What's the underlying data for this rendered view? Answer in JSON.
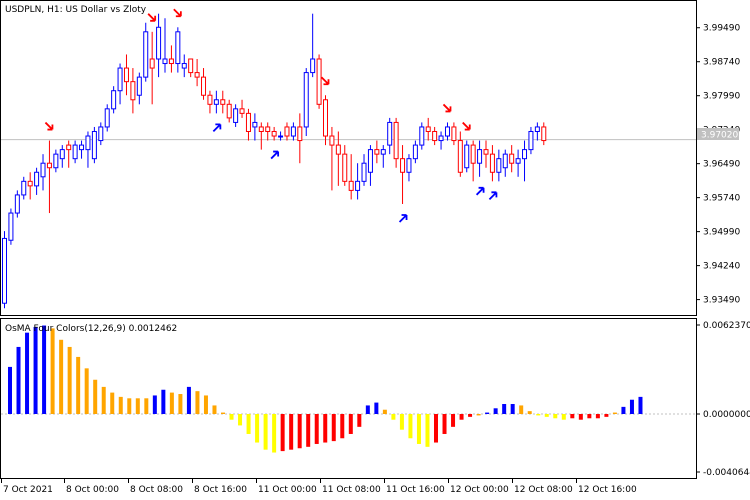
{
  "main": {
    "title": "USDPLN, H1:  US Dollar vs Zloty",
    "price_tag": "3.97020"
  },
  "indicator": {
    "title": "OsMA Four Colors(12,26,9) 0.0012462"
  },
  "chart_data": [
    {
      "type": "candlestick",
      "symbol": "USDPLN",
      "timeframe": "H1",
      "title": "USDPLN, H1:  US Dollar vs Zloty",
      "current_price": 3.9702,
      "ylim": [
        3.9315,
        4.0008
      ],
      "y_ticks": [
        "3.99490",
        "3.98740",
        "3.97990",
        "3.97240",
        "3.96490",
        "3.95740",
        "3.94990",
        "3.94240",
        "3.93490"
      ],
      "x_ticks": [
        "7 Oct 2021",
        "8 Oct 00:00",
        "8 Oct 08:00",
        "8 Oct 16:00",
        "11 Oct 00:00",
        "11 Oct 08:00",
        "11 Oct 16:00",
        "12 Oct 00:00",
        "12 Oct 08:00",
        "12 Oct 16:00"
      ],
      "colors": {
        "bull": "#0000ff",
        "bear": "#ff0000",
        "up_arrow": "#0000ff",
        "down_arrow": "#ff0000",
        "price_line": "#c0c0c0"
      },
      "candles": [
        [
          3.9341,
          3.95,
          3.933,
          3.9484
        ],
        [
          3.948,
          3.955,
          3.947,
          3.954
        ],
        [
          3.954,
          3.959,
          3.953,
          3.958
        ],
        [
          3.958,
          3.962,
          3.957,
          3.961
        ],
        [
          3.961,
          3.963,
          3.957,
          3.96
        ],
        [
          3.96,
          3.964,
          3.958,
          3.963
        ],
        [
          3.962,
          3.967,
          3.959,
          3.965
        ],
        [
          3.965,
          3.97,
          3.954,
          3.964
        ],
        [
          3.964,
          3.968,
          3.963,
          3.967
        ],
        [
          3.966,
          3.969,
          3.964,
          3.968
        ],
        [
          3.969,
          3.97,
          3.964,
          3.968
        ],
        [
          3.966,
          3.97,
          3.965,
          3.969
        ],
        [
          3.968,
          3.97,
          3.966,
          3.969
        ],
        [
          3.968,
          3.972,
          3.964,
          3.971
        ],
        [
          3.966,
          3.973,
          3.965,
          3.972
        ],
        [
          3.97,
          3.974,
          3.969,
          3.973
        ],
        [
          3.973,
          3.978,
          3.972,
          3.977
        ],
        [
          3.977,
          3.982,
          3.976,
          3.981
        ],
        [
          3.981,
          3.987,
          3.978,
          3.986
        ],
        [
          3.986,
          3.989,
          3.98,
          3.983
        ],
        [
          3.983,
          3.986,
          3.976,
          3.979
        ],
        [
          3.98,
          3.985,
          3.978,
          3.984
        ],
        [
          3.984,
          3.996,
          3.983,
          3.994
        ],
        [
          3.988,
          3.994,
          3.978,
          3.986
        ],
        [
          3.988,
          3.998,
          3.984,
          3.995
        ],
        [
          3.987,
          3.997,
          3.985,
          3.988
        ],
        [
          3.988,
          3.991,
          3.985,
          3.987
        ],
        [
          3.987,
          3.995,
          3.985,
          3.994
        ],
        [
          3.986,
          3.989,
          3.984,
          3.987
        ],
        [
          3.988,
          3.988,
          3.984,
          3.985
        ],
        [
          3.985,
          3.988,
          3.982,
          3.984
        ],
        [
          3.984,
          3.986,
          3.979,
          3.98
        ],
        [
          3.98,
          3.981,
          3.976,
          3.978
        ],
        [
          3.978,
          3.981,
          3.976,
          3.979
        ],
        [
          3.979,
          3.981,
          3.976,
          3.978
        ],
        [
          3.978,
          3.979,
          3.974,
          3.975
        ],
        [
          3.974,
          3.978,
          3.973,
          3.977
        ],
        [
          3.977,
          3.979,
          3.975,
          3.976
        ],
        [
          3.976,
          3.977,
          3.97,
          3.972
        ],
        [
          3.973,
          3.976,
          3.97,
          3.974
        ],
        [
          3.973,
          3.974,
          3.968,
          3.972
        ],
        [
          3.973,
          3.974,
          3.97,
          3.972
        ],
        [
          3.972,
          3.973,
          3.97,
          3.971
        ],
        [
          3.971,
          3.972,
          3.97,
          3.971
        ],
        [
          3.973,
          3.974,
          3.97,
          3.971
        ],
        [
          3.971,
          3.974,
          3.97,
          3.973
        ],
        [
          3.973,
          3.976,
          3.965,
          3.97
        ],
        [
          3.973,
          3.986,
          3.971,
          3.985
        ],
        [
          3.985,
          3.998,
          3.984,
          3.988
        ],
        [
          3.988,
          3.989,
          3.977,
          3.978
        ],
        [
          3.979,
          3.98,
          3.969,
          3.971
        ],
        [
          3.971,
          3.973,
          3.959,
          3.969
        ],
        [
          3.969,
          3.972,
          3.96,
          3.967
        ],
        [
          3.967,
          3.969,
          3.96,
          3.961
        ],
        [
          3.961,
          3.967,
          3.957,
          3.959
        ],
        [
          3.959,
          3.965,
          3.957,
          3.961
        ],
        [
          3.961,
          3.967,
          3.96,
          3.965
        ],
        [
          3.963,
          3.969,
          3.96,
          3.968
        ],
        [
          3.968,
          3.97,
          3.965,
          3.967
        ],
        [
          3.967,
          3.969,
          3.964,
          3.968
        ],
        [
          3.969,
          3.975,
          3.967,
          3.974
        ],
        [
          3.974,
          3.975,
          3.964,
          3.966
        ],
        [
          3.966,
          3.969,
          3.956,
          3.963
        ],
        [
          3.963,
          3.967,
          3.961,
          3.966
        ],
        [
          3.966,
          3.97,
          3.965,
          3.969
        ],
        [
          3.969,
          3.974,
          3.968,
          3.973
        ],
        [
          3.973,
          3.975,
          3.97,
          3.972
        ],
        [
          3.972,
          3.973,
          3.969,
          3.97
        ],
        [
          3.97,
          3.972,
          3.968,
          3.971
        ],
        [
          3.971,
          3.974,
          3.97,
          3.973
        ],
        [
          3.973,
          3.974,
          3.969,
          3.97
        ],
        [
          3.97,
          3.972,
          3.962,
          3.963
        ],
        [
          3.964,
          3.97,
          3.963,
          3.969
        ],
        [
          3.969,
          3.97,
          3.961,
          3.965
        ],
        [
          3.965,
          3.97,
          3.962,
          3.968
        ],
        [
          3.968,
          3.97,
          3.964,
          3.967
        ],
        [
          3.967,
          3.969,
          3.961,
          3.963
        ],
        [
          3.963,
          3.968,
          3.961,
          3.966
        ],
        [
          3.964,
          3.968,
          3.962,
          3.967
        ],
        [
          3.967,
          3.969,
          3.963,
          3.965
        ],
        [
          3.965,
          3.968,
          3.962,
          3.966
        ],
        [
          3.966,
          3.97,
          3.961,
          3.968
        ],
        [
          3.968,
          3.973,
          3.967,
          3.972
        ],
        [
          3.972,
          3.974,
          3.97,
          3.973
        ],
        [
          3.973,
          3.974,
          3.969,
          3.97
        ]
      ],
      "up_arrow_candles": [
        33,
        42,
        62,
        74,
        76
      ],
      "down_arrow_candles": [
        7,
        23,
        27,
        50,
        69,
        72
      ]
    },
    {
      "type": "bar",
      "title": "OsMA Four Colors(12,26,9) 0.0012462",
      "ylim": [
        -0.0040644,
        0.006237
      ],
      "y_ticks": [
        "0.0062370",
        "0.0000000",
        "-0.0040644"
      ],
      "colors": {
        "blue": "#0000ff",
        "orange": "#ffa500",
        "yellow": "#ffff00",
        "red": "#ff0000"
      },
      "values": [
        0.0033,
        0.0047,
        0.0057,
        0.0061,
        0.0062,
        0.006,
        0.0052,
        0.0047,
        0.004,
        0.0032,
        0.0024,
        0.0019,
        0.0015,
        0.0012,
        0.0011,
        0.0011,
        0.0011,
        0.0013,
        0.0017,
        0.0015,
        0.0014,
        0.0019,
        0.0016,
        0.0013,
        0.0006,
        0.0001,
        -0.0004,
        -0.0008,
        -0.0014,
        -0.002,
        -0.0025,
        -0.0027,
        -0.0026,
        -0.0025,
        -0.0024,
        -0.0023,
        -0.0021,
        -0.002,
        -0.0019,
        -0.0017,
        -0.0014,
        -0.0009,
        0.0006,
        0.0008,
        0.0003,
        -0.0004,
        -0.0011,
        -0.0017,
        -0.0021,
        -0.0023,
        -0.002,
        -0.0014,
        -0.0009,
        -0.0004,
        -0.0002,
        -0.0001,
        0.0001,
        0.0004,
        0.0007,
        0.0007,
        0.0006,
        0.0002,
        -0.0001,
        -0.0002,
        -0.0003,
        -0.0004,
        -0.0003,
        -0.0004,
        -0.0003,
        -0.0003,
        -0.0002,
        0.0001,
        0.0005,
        0.001,
        0.0012
      ],
      "bar_colors": [
        "blue",
        "blue",
        "blue",
        "blue",
        "blue",
        "orange",
        "orange",
        "orange",
        "orange",
        "orange",
        "orange",
        "orange",
        "orange",
        "orange",
        "orange",
        "orange",
        "orange",
        "blue",
        "blue",
        "orange",
        "orange",
        "blue",
        "orange",
        "orange",
        "orange",
        "orange",
        "yellow",
        "yellow",
        "yellow",
        "yellow",
        "yellow",
        "yellow",
        "red",
        "red",
        "red",
        "red",
        "red",
        "red",
        "red",
        "red",
        "red",
        "red",
        "blue",
        "blue",
        "orange",
        "yellow",
        "yellow",
        "yellow",
        "yellow",
        "yellow",
        "red",
        "red",
        "red",
        "red",
        "red",
        "orange",
        "blue",
        "blue",
        "blue",
        "blue",
        "orange",
        "orange",
        "yellow",
        "yellow",
        "yellow",
        "yellow",
        "red",
        "red",
        "red",
        "red",
        "red",
        "orange",
        "blue",
        "blue",
        "blue"
      ]
    }
  ]
}
